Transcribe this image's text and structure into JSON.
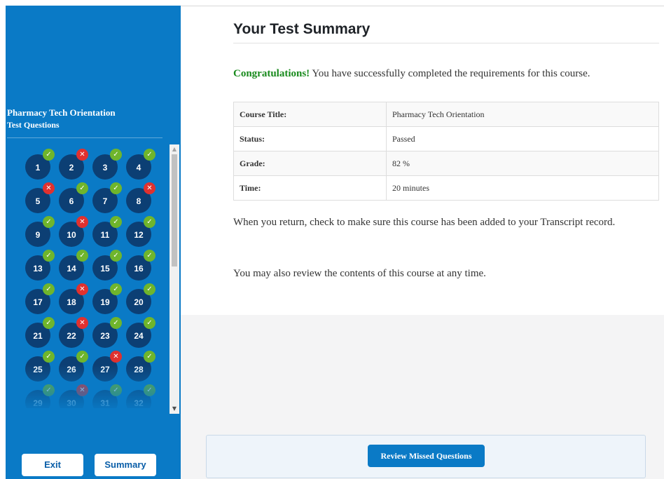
{
  "sidebar": {
    "course_title": "Pharmacy Tech Orientation",
    "section_label": "Test Questions",
    "questions": [
      {
        "n": "1",
        "correct": true
      },
      {
        "n": "2",
        "correct": false
      },
      {
        "n": "3",
        "correct": true
      },
      {
        "n": "4",
        "correct": true
      },
      {
        "n": "5",
        "correct": false
      },
      {
        "n": "6",
        "correct": true
      },
      {
        "n": "7",
        "correct": true
      },
      {
        "n": "8",
        "correct": false
      },
      {
        "n": "9",
        "correct": true
      },
      {
        "n": "10",
        "correct": false
      },
      {
        "n": "11",
        "correct": true
      },
      {
        "n": "12",
        "correct": true
      },
      {
        "n": "13",
        "correct": true
      },
      {
        "n": "14",
        "correct": true
      },
      {
        "n": "15",
        "correct": true
      },
      {
        "n": "16",
        "correct": true
      },
      {
        "n": "17",
        "correct": true
      },
      {
        "n": "18",
        "correct": false
      },
      {
        "n": "19",
        "correct": true
      },
      {
        "n": "20",
        "correct": true
      },
      {
        "n": "21",
        "correct": true
      },
      {
        "n": "22",
        "correct": false
      },
      {
        "n": "23",
        "correct": true
      },
      {
        "n": "24",
        "correct": true
      },
      {
        "n": "25",
        "correct": true
      },
      {
        "n": "26",
        "correct": true
      },
      {
        "n": "27",
        "correct": false
      },
      {
        "n": "28",
        "correct": true
      },
      {
        "n": "29",
        "correct": true
      },
      {
        "n": "30",
        "correct": false
      },
      {
        "n": "31",
        "correct": true
      },
      {
        "n": "32",
        "correct": true
      }
    ],
    "exit_label": "Exit",
    "summary_label": "Summary"
  },
  "main": {
    "title": "Your Test Summary",
    "congrats_emphasis": "Congratulations!",
    "congrats_text": " You have successfully completed the requirements for this course.",
    "table": [
      {
        "label": "Course Title:",
        "value": "Pharmacy Tech Orientation"
      },
      {
        "label": "Status:",
        "value": "Passed"
      },
      {
        "label": "Grade:",
        "value": "82 %"
      },
      {
        "label": "Time:",
        "value": "20 minutes"
      }
    ],
    "return_text": "When you return, check to make sure this course has been added to your Transcript record.",
    "review_text": "You may also review the contents of this course at any time.",
    "review_button": "Review Missed Questions"
  },
  "colors": {
    "sidebar_bg": "#0a7ac6",
    "question_circle": "#0c3f74",
    "correct_badge": "#6fb52c",
    "incorrect_badge": "#e0312f",
    "congrats_green": "#188a1c"
  },
  "icons": {
    "correct": "check-icon",
    "incorrect": "x-icon",
    "scroll_up": "scroll-up-arrow-icon",
    "scroll_down": "scroll-down-arrow-icon"
  }
}
